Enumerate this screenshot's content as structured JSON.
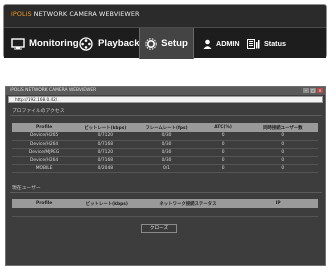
{
  "header": {
    "brand": "iPOLiS",
    "title_rest": " NETWORK CAMERA WEBVIEWER",
    "nav": [
      {
        "label": "Monitoring"
      },
      {
        "label": "Playback"
      },
      {
        "label": "Setup"
      },
      {
        "label": "ADMIN"
      },
      {
        "label": "Status"
      }
    ]
  },
  "window": {
    "title": "iPOLiS NETWORK CAMERA WEBVIEWER",
    "address": "http://192.168.0.42/",
    "address_tail": "...",
    "section1_title": "プロファイルのアクセス",
    "table1": {
      "headers": [
        "Profile",
        "ビットレート(kbps)",
        "フレームレート(fps)",
        "ATC(%)",
        "同時接続ユーザー数"
      ],
      "rows": [
        [
          "Device/H265",
          "0/7120",
          "0/30",
          "0",
          "0"
        ],
        [
          "Device/H264",
          "0/7168",
          "0/30",
          "0",
          "0"
        ],
        [
          "Device/MJPEG",
          "0/7120",
          "0/30",
          "0",
          "0"
        ],
        [
          "Device/H264",
          "0/7168",
          "0/30",
          "0",
          "0"
        ],
        [
          "MOBILE",
          "0/2048",
          "0/1",
          "0",
          "0"
        ]
      ]
    },
    "section2_title": "現在ユーザー",
    "table2": {
      "headers": [
        "Profile",
        "ビットレート(kbps)",
        "ネットワーク接続ステータス",
        "IP"
      ],
      "rows": [
        [
          "",
          "",
          "",
          ""
        ]
      ]
    },
    "close_label": "クローズ"
  },
  "colors": {
    "accent": "#f39a1f",
    "header_bg": "#2b2b2b",
    "dialog_bg": "#3d3d3d"
  }
}
